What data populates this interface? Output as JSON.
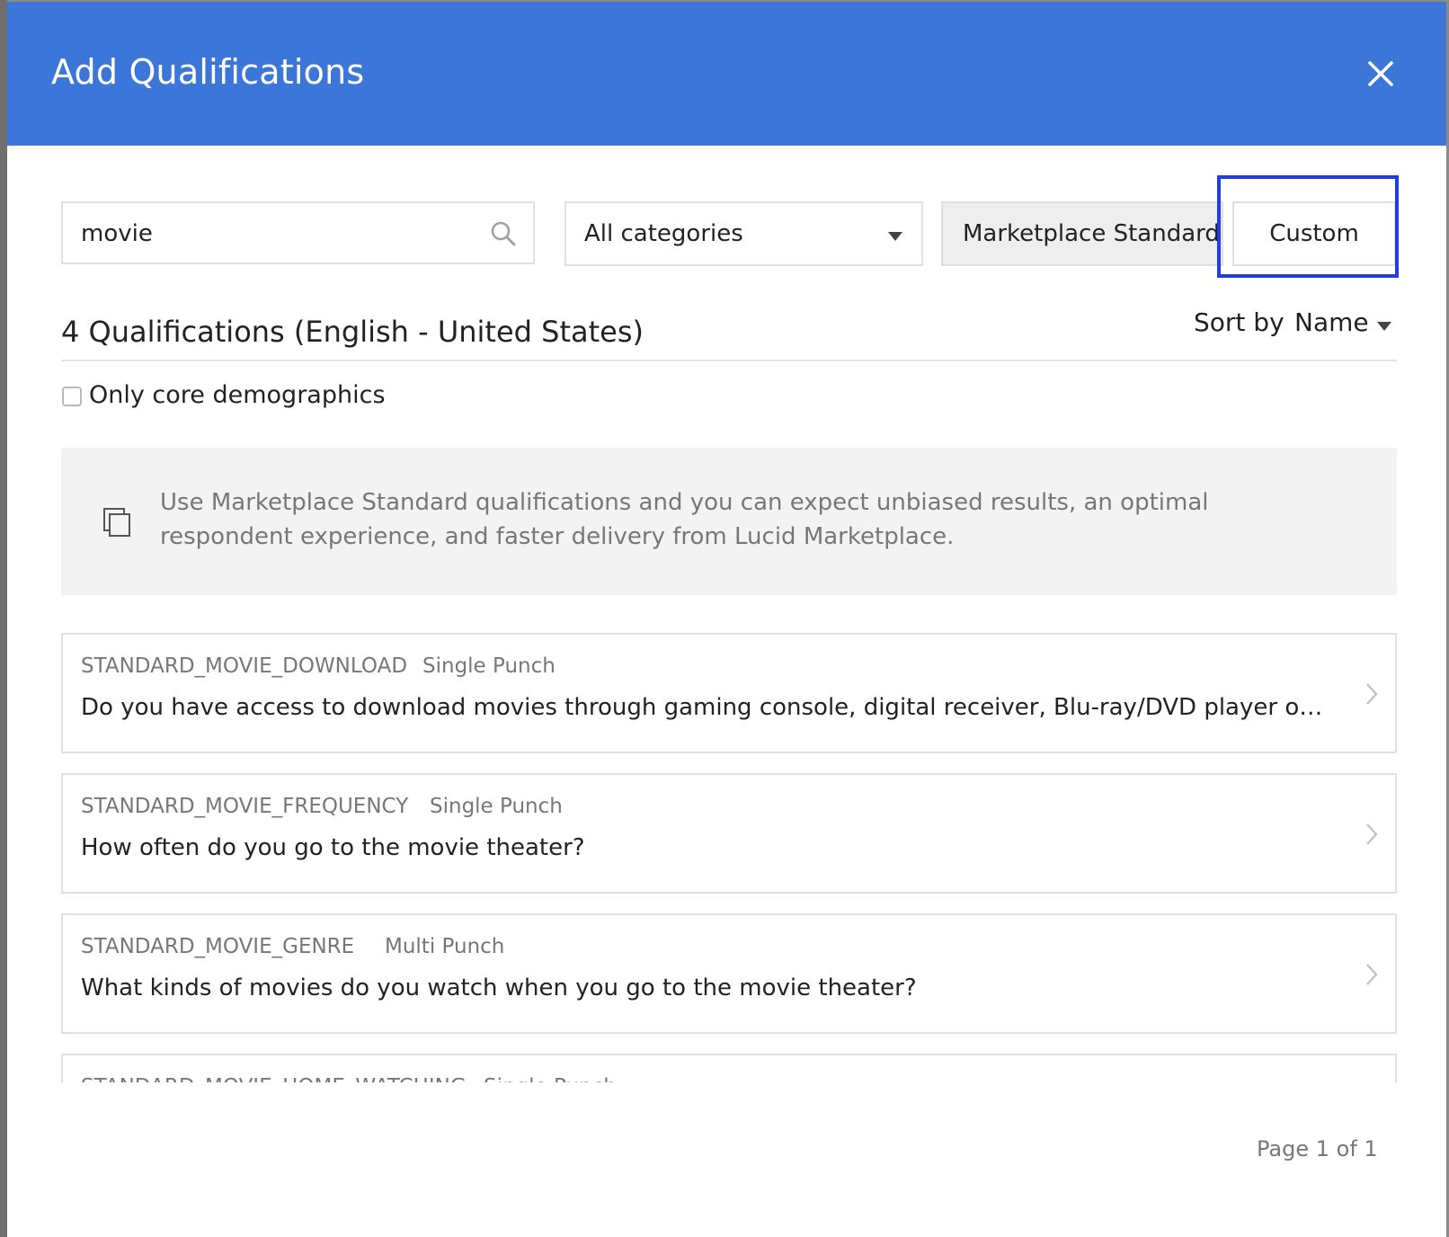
{
  "modal": {
    "title": "Add Qualifications"
  },
  "filters": {
    "search_value": "movie",
    "search_placeholder": "",
    "category_selected": "All categories",
    "segment_standard": "Marketplace Standard",
    "segment_custom": "Custom"
  },
  "results": {
    "title": "4 Qualifications (English - United States)",
    "sort_label": "Sort by",
    "sort_value": "Name"
  },
  "core_filter": {
    "label": "Only core demographics",
    "checked": false
  },
  "info": {
    "text": "Use Marketplace Standard qualifications and you can expect unbiased results, an optimal respondent experience, and faster delivery from Lucid Marketplace."
  },
  "qualifications": [
    {
      "code": "STANDARD_MOVIE_DOWNLOAD",
      "type": "Single Punch",
      "question": "Do you have access to download movies through gaming console, digital receiver, Blu-ray/DVD player or simi…"
    },
    {
      "code": "STANDARD_MOVIE_FREQUENCY",
      "type": "Single Punch",
      "question": "How often do you go to the movie theater?"
    },
    {
      "code": "STANDARD_MOVIE_GENRE",
      "type": "Multi Punch",
      "question": "What kinds of movies do you watch when you go to the movie theater?"
    },
    {
      "code": "STANDARD_MOVIE_HOME_WATCHING",
      "type": "Single Punch",
      "question": ""
    }
  ],
  "pager": {
    "text": "Page 1 of 1"
  },
  "colors": {
    "header": "#3b76d8",
    "focus_ring": "#1f3fe0"
  },
  "icons": {
    "close": "close-icon",
    "search": "search-icon",
    "dropdown": "caret-down-icon",
    "info": "layers-icon",
    "row_action": "chevron-right-icon"
  }
}
